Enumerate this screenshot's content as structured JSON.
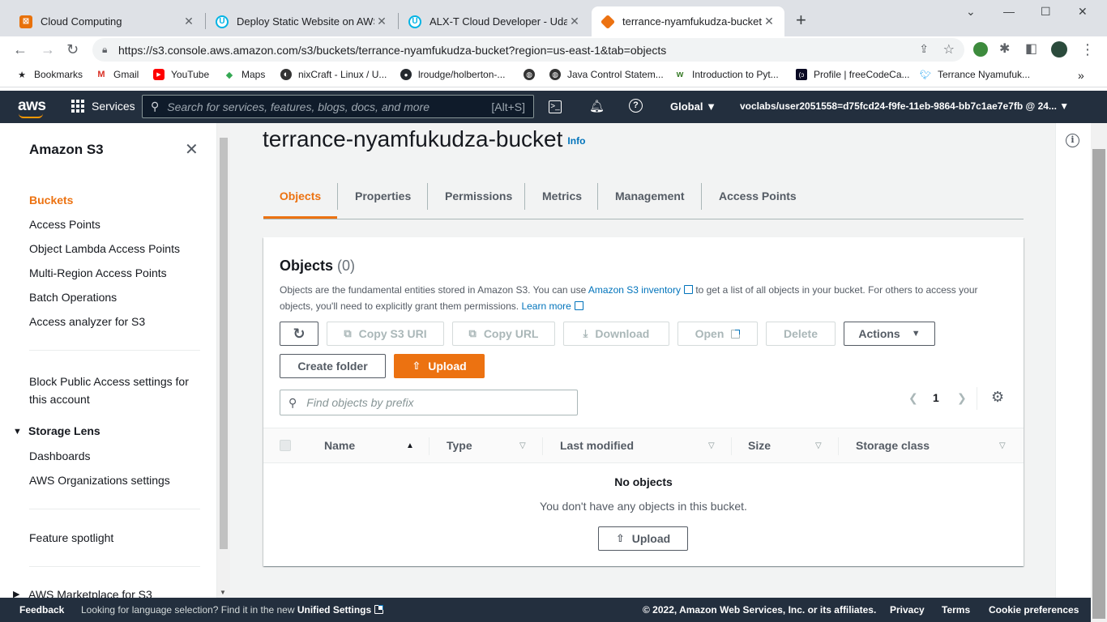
{
  "browser": {
    "tabs": [
      {
        "title": "Cloud Computing",
        "fav_color": "#e8710a"
      },
      {
        "title": "Deploy Static Website on AWS - U",
        "fav_color": "#02b3e4"
      },
      {
        "title": "ALX-T Cloud Developer - Udacity",
        "fav_color": "#02b3e4"
      },
      {
        "title": "terrance-nyamfukudza-bucket - S",
        "fav_color": "#ec7211"
      }
    ],
    "url": "https://s3.console.aws.amazon.com/s3/buckets/terrance-nyamfukudza-bucket?region=us-east-1&tab=objects",
    "bookmarks": [
      {
        "label": "Bookmarks",
        "icon": "star-icon"
      },
      {
        "label": "Gmail",
        "icon": "gmail-icon"
      },
      {
        "label": "YouTube",
        "icon": "youtube-icon"
      },
      {
        "label": "Maps",
        "icon": "maps-icon"
      },
      {
        "label": "nixCraft - Linux / U...",
        "icon": "nixcraft-icon"
      },
      {
        "label": "lroudge/holberton-...",
        "icon": "github-icon"
      },
      {
        "label": "",
        "icon": "globe-icon"
      },
      {
        "label": "Java Control Statem...",
        "icon": "globe-icon"
      },
      {
        "label": "Introduction to Pyt...",
        "icon": "w-icon"
      },
      {
        "label": "Profile | freeCodeCa...",
        "icon": "freecodecamp-icon"
      },
      {
        "label": "Terrance Nyamufuk...",
        "icon": "twitter-icon"
      }
    ]
  },
  "aws_nav": {
    "logo": "aws",
    "services": "Services",
    "search_placeholder": "Search for services, features, blogs, docs, and more",
    "search_shortcut": "[Alt+S]",
    "region": "Global",
    "account": "voclabs/user2051558=d75fcd24-f9fe-11eb-9864-bb7c1ae7e7fb @ 24..."
  },
  "sidebar": {
    "title": "Amazon S3",
    "items": [
      {
        "label": "Buckets",
        "active": true
      },
      {
        "label": "Access Points"
      },
      {
        "label": "Object Lambda Access Points"
      },
      {
        "label": "Multi-Region Access Points"
      },
      {
        "label": "Batch Operations"
      },
      {
        "label": "Access analyzer for S3"
      }
    ],
    "block_public_line1": "Block Public Access settings for",
    "block_public_line2": "this account",
    "storage_lens": "Storage Lens",
    "storage_lens_items": [
      "Dashboards",
      "AWS Organizations settings"
    ],
    "feature_spotlight": "Feature spotlight",
    "marketplace": "AWS Marketplace for S3"
  },
  "main": {
    "bucket_name": "terrance-nyamfukudza-bucket",
    "info": "Info",
    "tabs": [
      "Objects",
      "Properties",
      "Permissions",
      "Metrics",
      "Management",
      "Access Points"
    ],
    "objects": {
      "title": "Objects",
      "count": "(0)",
      "desc_1": "Objects are the fundamental entities stored in Amazon S3. You can use ",
      "desc_link1": "Amazon S3 inventory",
      "desc_2": " to get a list of all objects in your bucket. For others to access your objects, you'll need to explicitly grant them permissions. ",
      "desc_link2": "Learn more",
      "buttons": {
        "copy_uri": "Copy S3 URI",
        "copy_url": "Copy URL",
        "download": "Download",
        "open": "Open",
        "delete": "Delete",
        "actions": "Actions",
        "create_folder": "Create folder",
        "upload": "Upload"
      },
      "filter_placeholder": "Find objects by prefix",
      "page": "1",
      "columns": [
        "Name",
        "Type",
        "Last modified",
        "Size",
        "Storage class"
      ],
      "empty_title": "No objects",
      "empty_desc": "You don't have any objects in this bucket.",
      "empty_upload": "Upload"
    }
  },
  "footer": {
    "feedback": "Feedback",
    "lang_text": "Looking for language selection? Find it in the new ",
    "lang_link": "Unified Settings",
    "copyright": "© 2022, Amazon Web Services, Inc. or its affiliates.",
    "privacy": "Privacy",
    "terms": "Terms",
    "cookies": "Cookie preferences"
  },
  "colors": {
    "accent": "#ec7211",
    "link": "#0073bb",
    "nav_bg": "#232f3e"
  }
}
